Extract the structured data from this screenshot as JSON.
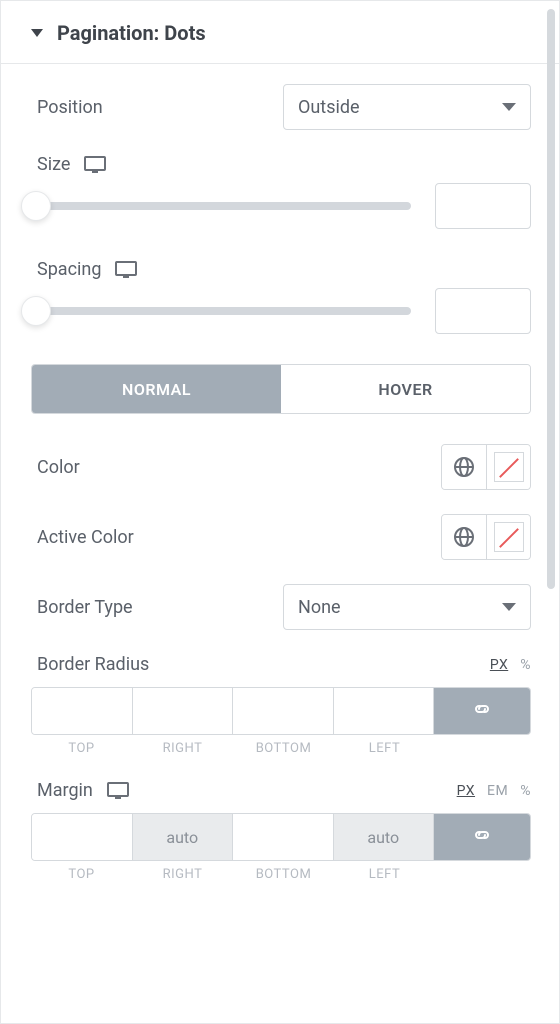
{
  "section": {
    "title": "Pagination: Dots"
  },
  "position": {
    "label": "Position",
    "value": "Outside"
  },
  "size": {
    "label": "Size",
    "value": ""
  },
  "spacing": {
    "label": "Spacing",
    "value": ""
  },
  "tabs": {
    "normal": "NORMAL",
    "hover": "HOVER"
  },
  "color": {
    "label": "Color"
  },
  "active_color": {
    "label": "Active Color"
  },
  "border_type": {
    "label": "Border Type",
    "value": "None"
  },
  "border_radius": {
    "label": "Border Radius",
    "units": {
      "px": "PX",
      "pct": "%"
    },
    "values": {
      "top": "",
      "right": "",
      "bottom": "",
      "left": ""
    },
    "sides": {
      "top": "TOP",
      "right": "RIGHT",
      "bottom": "BOTTOM",
      "left": "LEFT"
    }
  },
  "margin": {
    "label": "Margin",
    "units": {
      "px": "PX",
      "em": "EM",
      "pct": "%"
    },
    "values": {
      "top": "",
      "right": "auto",
      "bottom": "",
      "left": "auto"
    },
    "sides": {
      "top": "TOP",
      "right": "RIGHT",
      "bottom": "BOTTOM",
      "left": "LEFT"
    }
  }
}
